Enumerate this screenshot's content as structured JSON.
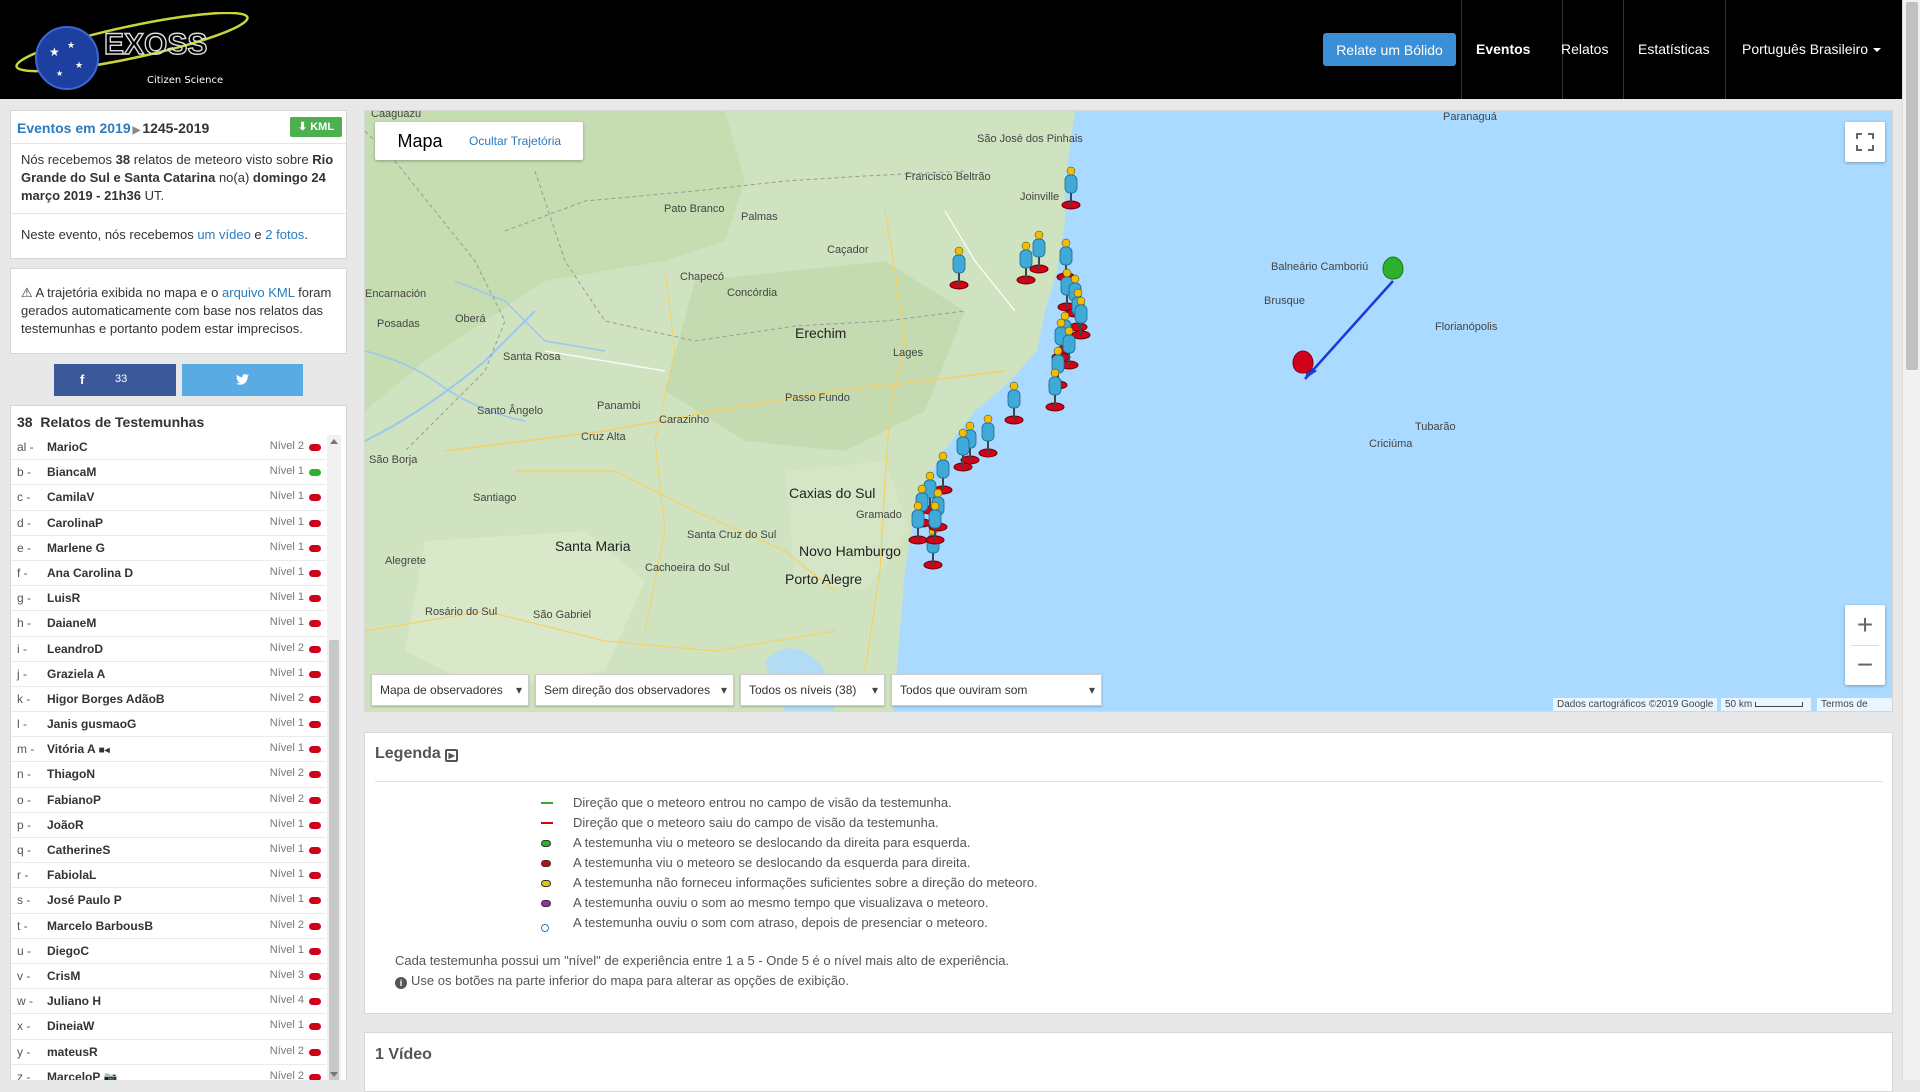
{
  "header": {
    "brand": "EXOSS",
    "tagline": "Citizen Science",
    "report_button": "Relate um Bólido",
    "nav": [
      {
        "label": "Eventos",
        "active": true
      },
      {
        "label": "Relatos",
        "active": false
      },
      {
        "label": "Estatísticas",
        "active": false
      },
      {
        "label": "Português Brasileiro",
        "active": false
      }
    ]
  },
  "event": {
    "title_link": "Eventos em 2019",
    "event_id": "1245-2019",
    "kml_label": "KML",
    "desc_p1": "Nós recebemos ",
    "count": "38",
    "desc_p2": " relatos de meteoro visto sobre ",
    "regions": "Rio Grande do Sul e Santa Catarina",
    "desc_p3": " no(a) ",
    "date": "domingo 24 março 2019 - 21h36",
    "desc_p4": " UT.",
    "media_p1": "Neste evento, nós recebemos ",
    "media_video": "um vídeo",
    "media_and": " e ",
    "media_photos": "2 fotos",
    "media_end": "."
  },
  "warning": {
    "p1": " A trajetória exibida no mapa e o ",
    "link": "arquivo KML",
    "p2": " foram gerados automaticamente com base nos relatos das testemunhas e portanto podem estar imprecisos."
  },
  "share": {
    "facebook_count": "33"
  },
  "witnesses": {
    "count": "38",
    "title": "Relatos de Testemunhas",
    "rows": [
      {
        "code": "al -",
        "name": "MarioC",
        "level": "Nível 2",
        "color": "red"
      },
      {
        "code": "b -",
        "name": "BiancaM",
        "level": "Nível 1",
        "color": "green"
      },
      {
        "code": "c -",
        "name": "CamilaV",
        "level": "Nível 1",
        "color": "red"
      },
      {
        "code": "d -",
        "name": "CarolinaP",
        "level": "Nível 1",
        "color": "red"
      },
      {
        "code": "e -",
        "name": "Marlene G",
        "level": "Nível 1",
        "color": "red"
      },
      {
        "code": "f -",
        "name": "Ana Carolina D",
        "level": "Nível 1",
        "color": "red"
      },
      {
        "code": "g -",
        "name": "LuisR",
        "level": "Nível 1",
        "color": "red"
      },
      {
        "code": "h -",
        "name": "DaianeM",
        "level": "Nível 1",
        "color": "red"
      },
      {
        "code": "i -",
        "name": "LeandroD",
        "level": "Nível 2",
        "color": "red"
      },
      {
        "code": "j -",
        "name": "Graziela A",
        "level": "Nível 1",
        "color": "red"
      },
      {
        "code": "k -",
        "name": "Higor Borges AdãoB",
        "level": "Nível 2",
        "color": "red"
      },
      {
        "code": "l -",
        "name": "Janis gusmaoG",
        "level": "Nível 1",
        "color": "red"
      },
      {
        "code": "m -",
        "name": "Vitória A",
        "level": "Nível 1",
        "color": "red",
        "icon": "video"
      },
      {
        "code": "n -",
        "name": "ThiagoN",
        "level": "Nível 2",
        "color": "red"
      },
      {
        "code": "o -",
        "name": "FabianoP",
        "level": "Nível 2",
        "color": "red"
      },
      {
        "code": "p -",
        "name": "JoãoR",
        "level": "Nível 1",
        "color": "red"
      },
      {
        "code": "q -",
        "name": "CatherineS",
        "level": "Nível 1",
        "color": "red"
      },
      {
        "code": "r -",
        "name": "FabiolaL",
        "level": "Nível 1",
        "color": "red"
      },
      {
        "code": "s -",
        "name": "José Paulo P",
        "level": "Nível 1",
        "color": "red"
      },
      {
        "code": "t -",
        "name": "Marcelo BarbousB",
        "level": "Nível 2",
        "color": "red"
      },
      {
        "code": "u -",
        "name": "DiegoC",
        "level": "Nível 1",
        "color": "red"
      },
      {
        "code": "v -",
        "name": "CrisM",
        "level": "Nível 3",
        "color": "red"
      },
      {
        "code": "w -",
        "name": "Juliano H",
        "level": "Nível 4",
        "color": "red"
      },
      {
        "code": "x -",
        "name": "DineiaW",
        "level": "Nível 1",
        "color": "red"
      },
      {
        "code": "y -",
        "name": "mateusR",
        "level": "Nível 2",
        "color": "red"
      },
      {
        "code": "z -",
        "name": "MarceloP",
        "level": "Nível 2",
        "color": "red",
        "icon": "camera"
      }
    ]
  },
  "map": {
    "tab_map": "Mapa",
    "tab_hide": "Ocultar Trajetória",
    "selects": [
      "Mapa de observadores",
      "Sem direção dos observadores",
      "Todos os níveis (38)",
      "Todos que ouviram som"
    ],
    "attribution": "Dados cartográficos ©2019 Google",
    "scale": "50 km",
    "terms": "Termos de Uso",
    "places": [
      {
        "name": "Caaguazu"
      },
      {
        "name": "Paranaguá"
      },
      {
        "name": "São José dos Pinhais"
      },
      {
        "name": "Francisco Beltrão"
      },
      {
        "name": "Pato Branco"
      },
      {
        "name": "Palmas"
      },
      {
        "name": "Joinville"
      },
      {
        "name": "Caçador"
      },
      {
        "name": "Balneário Camboriú"
      },
      {
        "name": "Chapecó"
      },
      {
        "name": "Concórdia"
      },
      {
        "name": "Brusque"
      },
      {
        "name": "Encarnación"
      },
      {
        "name": "Posadas"
      },
      {
        "name": "Oberá"
      },
      {
        "name": "Erechim"
      },
      {
        "name": "Florianópolis"
      },
      {
        "name": "Lages"
      },
      {
        "name": "Santa Rosa"
      },
      {
        "name": "Passo Fundo"
      },
      {
        "name": "Santo Ângelo"
      },
      {
        "name": "Panambi"
      },
      {
        "name": "Carazinho"
      },
      {
        "name": "Cruz Alta"
      },
      {
        "name": "Tubarão"
      },
      {
        "name": "Criciúma"
      },
      {
        "name": "São Borja"
      },
      {
        "name": "Santiago"
      },
      {
        "name": "Caxias do Sul"
      },
      {
        "name": "Gramado"
      },
      {
        "name": "Santa Maria"
      },
      {
        "name": "Santa Cruz do Sul"
      },
      {
        "name": "Novo Hamburgo"
      },
      {
        "name": "Porto Alegre"
      },
      {
        "name": "Alegrete"
      },
      {
        "name": "Cachoeira do Sul"
      },
      {
        "name": "Rosário do Sul"
      },
      {
        "name": "São Gabriel"
      }
    ]
  },
  "legend": {
    "title": "Legenda",
    "items": [
      {
        "type": "line",
        "color": "#2db12d",
        "text": "Direção que o meteoro entrou no campo de visão da testemunha."
      },
      {
        "type": "line",
        "color": "#d0021b",
        "text": "Direção que o meteoro saiu do campo de visão da testemunha."
      },
      {
        "type": "dot",
        "color": "#2db12d",
        "text": "A testemunha viu o meteoro se deslocando da direita para esquerda."
      },
      {
        "type": "dot",
        "color": "#d0021b",
        "text": "A testemunha viu o meteoro se deslocando da esquerda para direita."
      },
      {
        "type": "dot",
        "color": "#e6c200",
        "text": "A testemunha não forneceu informações suficientes sobre a direção do meteoro."
      },
      {
        "type": "dot",
        "color": "#9c27b0",
        "text": "A testemunha ouviu o som ao mesmo tempo que visualizava o meteoro."
      },
      {
        "type": "ring",
        "color": "#2a7bbf",
        "text": "A testemunha ouviu o som com atraso, depois de presenciar o meteoro."
      }
    ],
    "foot1": "Cada testemunha possui um \"nível\" de experiência entre 1 a 5 - Onde 5 é o nível mais alto de experiência.",
    "foot2": "Use os botões na parte inferior do mapa para alterar as opções de exibição."
  },
  "video": {
    "title": "1 Vídeo"
  }
}
